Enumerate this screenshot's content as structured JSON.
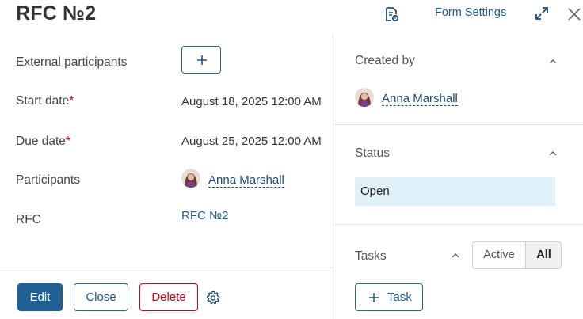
{
  "header": {
    "title": "RFC №2",
    "form_settings_label": "Form Settings",
    "icons": [
      "document-settings-icon",
      "expand-icon",
      "close-icon"
    ]
  },
  "fields": {
    "external_participants_label": "External participants",
    "start_date_label": "Start date",
    "start_date_value": "August 18, 2025 12:00 AM",
    "due_date_label": "Due date",
    "due_date_value": "August 25, 2025 12:00 AM",
    "participants_label": "Participants",
    "participants_user": "Anna Marshall",
    "rfc_label": "RFC",
    "rfc_value": "RFC №2",
    "required_mark": "*"
  },
  "actions": {
    "edit_label": "Edit",
    "close_label": "Close",
    "delete_label": "Delete"
  },
  "side": {
    "created_by_title": "Created by",
    "created_by_user": "Anna Marshall",
    "status_title": "Status",
    "status_value": "Open",
    "tasks_title": "Tasks",
    "filter_active": "Active",
    "filter_all": "All",
    "filter_selected": "All",
    "task_button_label": "Task"
  },
  "colors": {
    "accent": "#1f5f94",
    "link": "#1e5b8f",
    "danger": "#d0021b",
    "status_bg": "#dff0f8"
  }
}
